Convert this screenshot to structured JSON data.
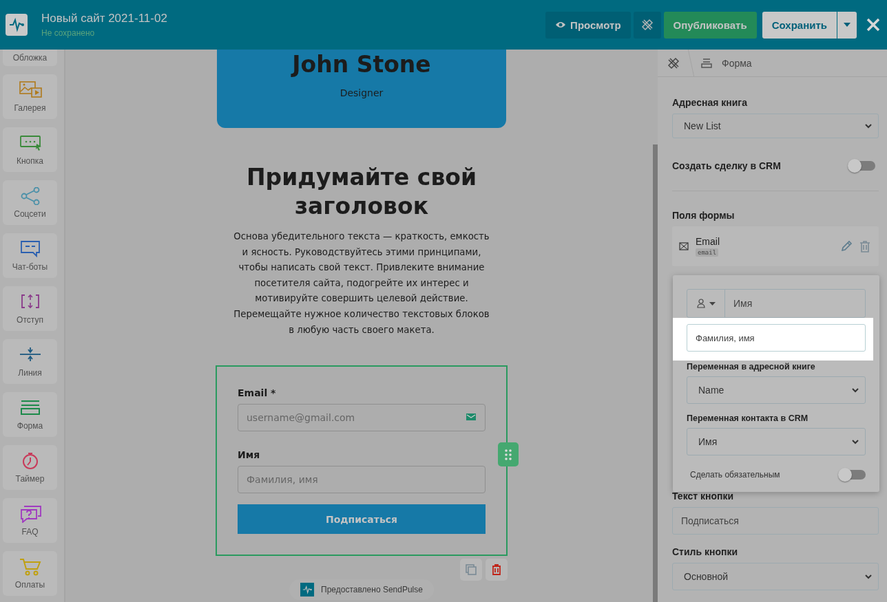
{
  "header": {
    "title": "Новый сайт 2021-11-02",
    "status": "Не сохранено",
    "buttons": [
      {
        "kind": "preview",
        "label": "Просмотр"
      },
      {
        "kind": "design"
      },
      {
        "kind": "publish",
        "label": "Опубликовать"
      },
      {
        "kind": "save",
        "label": "Сохранить"
      }
    ]
  },
  "sidebar": {
    "items": [
      {
        "kind": "cover",
        "label": "Обложка"
      },
      {
        "kind": "gallery",
        "label": "Галерея"
      },
      {
        "kind": "button",
        "label": "Кнопка"
      },
      {
        "kind": "social",
        "label": "Соцсети"
      },
      {
        "kind": "chatbot",
        "label": "Чат-боты"
      },
      {
        "kind": "spacing",
        "label": "Отступ"
      },
      {
        "kind": "line",
        "label": "Линия"
      },
      {
        "kind": "form",
        "label": "Форма"
      },
      {
        "kind": "timer",
        "label": "Таймер"
      },
      {
        "kind": "faq",
        "label": "FAQ"
      },
      {
        "kind": "payment",
        "label": "Оплаты"
      }
    ]
  },
  "canvas": {
    "profile": {
      "name": "John Stone",
      "role": "Designer"
    },
    "heading": "Придумайте свой заголовок",
    "body": "Основа убедительного текста — краткость, емкость и ясность. Руководствуйтесь этими принципами, чтобы написать свой текст. Привлеките внимание посетителя сайта, подогрейте их интерес и мотивируйте совершить целевой действие. Перемещайте нужное количество текстовых блоков в любую часть своего макета.",
    "form": {
      "fields": [
        {
          "kind": "email",
          "label": "Email *",
          "placeholder": "username@gmail.com"
        },
        {
          "kind": "text",
          "label": "Имя",
          "placeholder": "Фамилия, имя"
        }
      ],
      "submit": "Подписаться"
    },
    "footer": "Предоставлено SendPulse"
  },
  "panel": {
    "breadcrumb": "Форма",
    "address_book": {
      "label": "Адресная книга",
      "value": "New List"
    },
    "crm_deal": {
      "label": "Создать сделку в CRM",
      "on": false
    },
    "form_fields": {
      "title": "Поля формы",
      "items": [
        {
          "name": "Email",
          "tag": "email"
        }
      ]
    },
    "field_editor": {
      "name": "Имя",
      "placeholder_value": "Фамилия, имя",
      "variable": {
        "label": "Переменная в адресной книге",
        "value": "Name"
      },
      "crm_variable": {
        "label": "Переменная контакта в CRM",
        "value": "Имя"
      },
      "required": {
        "label": "Сделать обязательным",
        "on": false
      }
    },
    "button_text": {
      "label": "Текст кнопки",
      "value": "Подписаться"
    },
    "button_style": {
      "label": "Стиль кнопки",
      "value": "Основной"
    }
  }
}
